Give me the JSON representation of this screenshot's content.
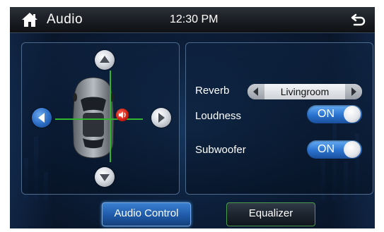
{
  "header": {
    "title": "Audio",
    "time": "12:30 PM"
  },
  "balance_panel": {
    "arrows": [
      "up",
      "down",
      "left",
      "right"
    ],
    "active_arrow": "left",
    "line_color": "#31b52f"
  },
  "settings": {
    "reverb": {
      "label": "Reverb",
      "value": "Livingroom"
    },
    "loudness": {
      "label": "Loudness",
      "state": "ON"
    },
    "subwoofer": {
      "label": "Subwoofer",
      "state": "ON"
    }
  },
  "footer": {
    "audio_control_label": "Audio Control",
    "equalizer_label": "Equalizer",
    "active_tab": "Audio Control"
  },
  "colors": {
    "accent": "#2a73cf",
    "background": "#0c1f3a",
    "active_button": "#1f5aa8",
    "speaker": "#d01e12"
  },
  "icons": [
    "home-icon",
    "back-icon",
    "up-arrow-icon",
    "down-arrow-icon",
    "left-arrow-icon",
    "right-arrow-icon",
    "car-icon",
    "speaker-icon"
  ]
}
